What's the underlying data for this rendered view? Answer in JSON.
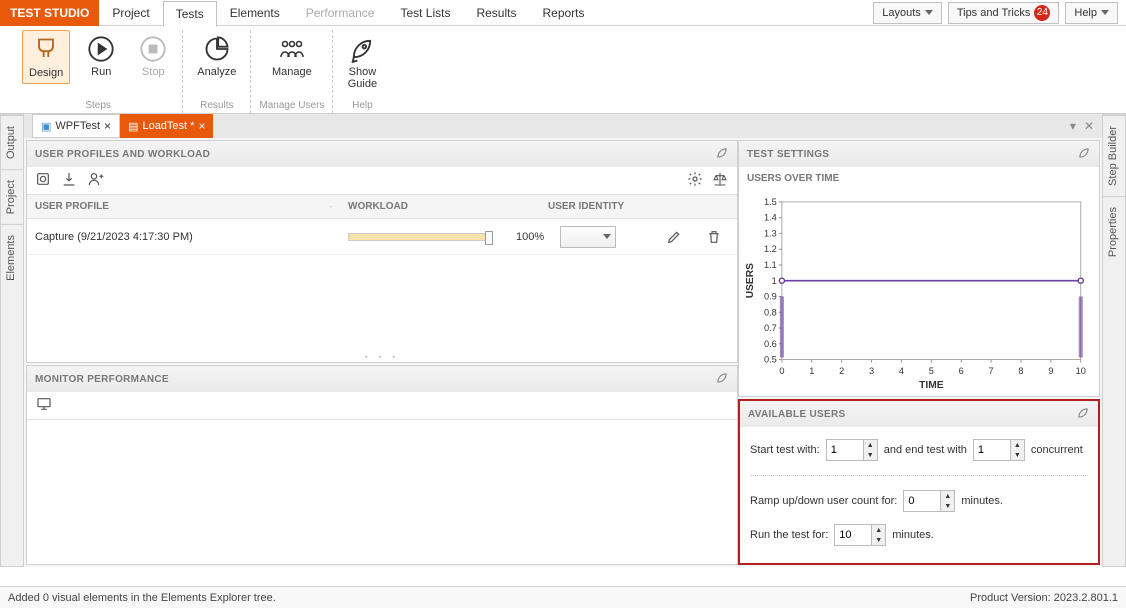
{
  "brand": "TEST STUDIO",
  "menu_tabs": [
    "Project",
    "Tests",
    "Elements",
    "Performance",
    "Test Lists",
    "Results",
    "Reports"
  ],
  "active_menu_tab": "Tests",
  "disabled_menu_tab": "Performance",
  "menu_right": {
    "layouts": "Layouts",
    "tips": "Tips and Tricks",
    "tips_badge": "24",
    "help": "Help"
  },
  "ribbon": {
    "design": "Design",
    "run": "Run",
    "stop": "Stop",
    "analyze": "Analyze",
    "manage": "Manage",
    "show_guide_l1": "Show",
    "show_guide_l2": "Guide",
    "group_steps": "Steps",
    "group_results": "Results",
    "group_users": "Manage Users",
    "group_help": "Help"
  },
  "side_left": [
    "Output",
    "Project",
    "Elements"
  ],
  "side_right": [
    "Step Builder",
    "Properties"
  ],
  "doc_tabs": [
    {
      "label": "WPFTest",
      "active": false
    },
    {
      "label": "LoadTest *",
      "active": true
    }
  ],
  "panels": {
    "profiles_title": "USER PROFILES AND WORKLOAD",
    "cols": {
      "profile": "USER PROFILE",
      "workload": "WORKLOAD",
      "identity": "USER IDENTITY"
    },
    "row": {
      "name": "Capture (9/21/2023 4:17:30 PM)",
      "workload_pct": "100%"
    },
    "monitor_title": "MONITOR PERFORMANCE",
    "settings_title": "TEST SETTINGS",
    "users_over_time": "USERS OVER TIME",
    "available_title": "AVAILABLE USERS",
    "avail": {
      "start_label": "Start test with:",
      "start_val": "1",
      "end_label": "and end test with",
      "end_val": "1",
      "concurrent": "concurrent",
      "ramp_label": "Ramp up/down user count for:",
      "ramp_val": "0",
      "minutes": "minutes.",
      "run_label": "Run the test for:",
      "run_val": "10"
    }
  },
  "statusbar": {
    "left": "Added 0 visual elements in the Elements Explorer tree.",
    "right": "Product Version: 2023.2.801.1"
  },
  "chart_data": {
    "type": "line",
    "xlabel": "TIME",
    "ylabel": "USERS",
    "x_ticks": [
      0,
      1,
      2,
      3,
      4,
      5,
      6,
      7,
      8,
      9,
      10
    ],
    "y_ticks": [
      0.5,
      0.6,
      0.7,
      0.8,
      0.9,
      1,
      1.1,
      1.2,
      1.3,
      1.4,
      1.5
    ],
    "series": [
      {
        "name": "users",
        "x": [
          0,
          10
        ],
        "y": [
          1,
          1
        ]
      }
    ],
    "markers": [
      {
        "x": 0,
        "y": 0.9,
        "type": "bar"
      },
      {
        "x": 10,
        "y": 0.9,
        "type": "bar"
      }
    ]
  }
}
